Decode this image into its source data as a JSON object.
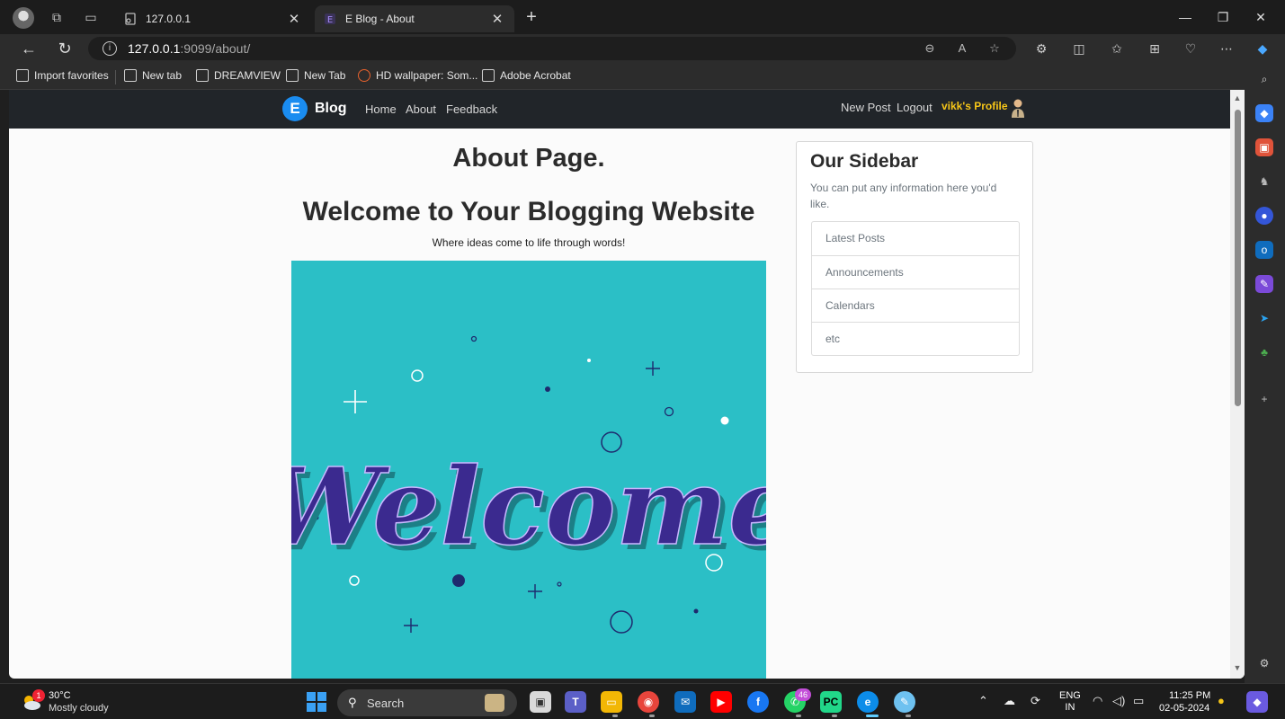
{
  "browser": {
    "tabs": [
      {
        "title": "127.0.0.1",
        "active": false
      },
      {
        "title": "E Blog - About",
        "active": true
      }
    ],
    "url_host": "127.0.0.1",
    "url_path": ":9099/about/",
    "favorites": [
      {
        "label": "Import favorites"
      },
      {
        "label": "New tab"
      },
      {
        "label": "DREAMVIEW"
      },
      {
        "label": "New Tab"
      },
      {
        "label": "HD wallpaper: Som..."
      },
      {
        "label": "Adobe Acrobat"
      }
    ]
  },
  "site": {
    "brand_letter": "E",
    "brand_name": "Blog",
    "nav_links": [
      "Home",
      "About",
      "Feedback"
    ],
    "right_links": [
      "New Post",
      "Logout"
    ],
    "profile_label": "vikk's Profile",
    "colors": {
      "navbar": "#212529",
      "brand": "#1a8cf0",
      "profile": "#f5c518",
      "hero_bg": "#2bbfc6",
      "hero_text": "#3b2a8f"
    }
  },
  "main": {
    "page_title": "About Page.",
    "heading": "Welcome to Your Blogging Website",
    "tagline": "Where ideas come to life through words!",
    "hero_word": "Welcome"
  },
  "sidebar": {
    "title": "Our Sidebar",
    "text": "You can put any information here you'd like.",
    "items": [
      "Latest Posts",
      "Announcements",
      "Calendars",
      "etc"
    ]
  },
  "taskbar": {
    "weather_badge": "1",
    "temperature": "30°C",
    "condition": "Mostly cloudy",
    "search_label": "Search",
    "whatsapp_badge": "46",
    "lang_top": "ENG",
    "lang_bottom": "IN",
    "time": "11:25 PM",
    "date": "02-05-2024"
  }
}
